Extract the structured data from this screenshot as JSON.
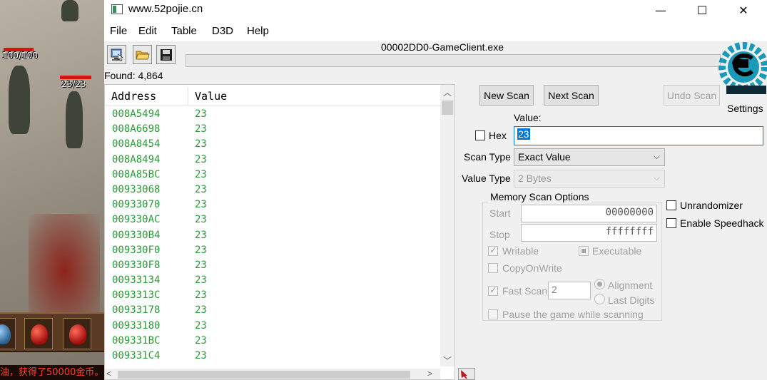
{
  "game": {
    "hp_left": "100/100",
    "hp_right": "23/23",
    "message": "油，获得了50000金币。"
  },
  "window": {
    "title": "www.52pojie.cn",
    "minimize": "—",
    "maximize": "☐",
    "close": "✕"
  },
  "menu": [
    "File",
    "Edit",
    "Table",
    "D3D",
    "Help"
  ],
  "toolbar": {
    "process_title": "00002DD0-GameClient.exe"
  },
  "found_label": "Found: 4,864",
  "settings_label": "Settings",
  "results": {
    "col_address": "Address",
    "col_value": "Value",
    "rows": [
      {
        "address": "008A5494",
        "value": "23"
      },
      {
        "address": "008A6698",
        "value": "23"
      },
      {
        "address": "008A8454",
        "value": "23"
      },
      {
        "address": "008A8494",
        "value": "23"
      },
      {
        "address": "008A85BC",
        "value": "23"
      },
      {
        "address": "00933068",
        "value": "23"
      },
      {
        "address": "00933070",
        "value": "23"
      },
      {
        "address": "009330AC",
        "value": "23"
      },
      {
        "address": "009330B4",
        "value": "23"
      },
      {
        "address": "009330F0",
        "value": "23"
      },
      {
        "address": "009330F8",
        "value": "23"
      },
      {
        "address": "00933134",
        "value": "23"
      },
      {
        "address": "0093313C",
        "value": "23"
      },
      {
        "address": "00933178",
        "value": "23"
      },
      {
        "address": "00933180",
        "value": "23"
      },
      {
        "address": "009331BC",
        "value": "23"
      },
      {
        "address": "009331C4",
        "value": "23"
      }
    ]
  },
  "scan": {
    "new_scan": "New Scan",
    "next_scan": "Next Scan",
    "undo_scan": "Undo Scan",
    "value_label": "Value:",
    "hex_label": "Hex",
    "value_input": "23",
    "scan_type_label": "Scan Type",
    "scan_type_value": "Exact Value",
    "value_type_label": "Value Type",
    "value_type_value": "2 Bytes"
  },
  "memory_options": {
    "title": "Memory Scan Options",
    "start_label": "Start",
    "start_value": "00000000",
    "stop_label": "Stop",
    "stop_value": "ffffffff",
    "writable": "Writable",
    "executable": "Executable",
    "copy_on_write": "CopyOnWrite",
    "fast_scan": "Fast Scan",
    "fast_scan_value": "2",
    "alignment": "Alignment",
    "last_digits": "Last Digits",
    "pause_game": "Pause the game while scanning"
  },
  "extra": {
    "unrandomizer": "Unrandomizer",
    "speedhack": "Enable Speedhack"
  },
  "colors": {
    "result_text": "#2a9a3a",
    "logo": "#1a9ab8"
  }
}
